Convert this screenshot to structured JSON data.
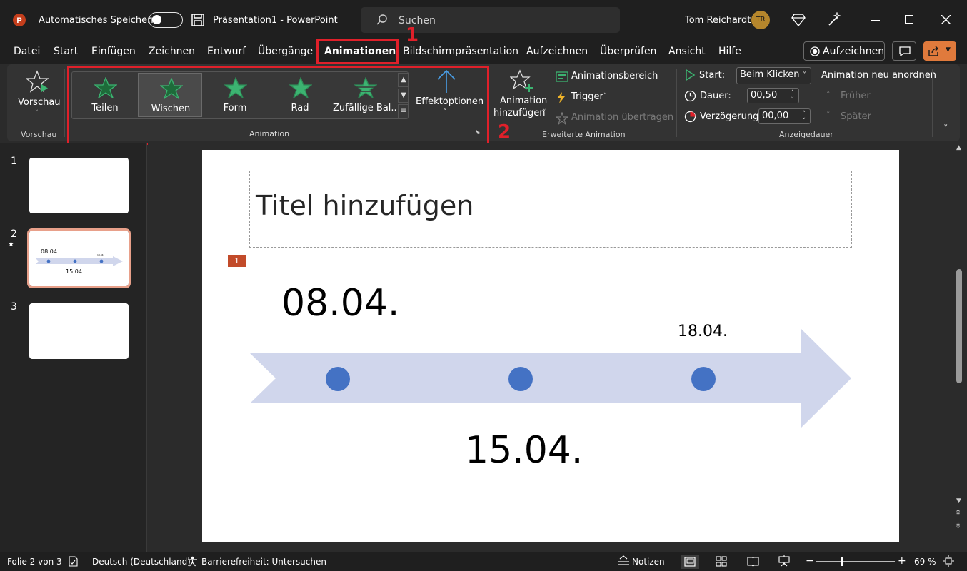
{
  "titlebar": {
    "autosave_label": "Automatisches Speichern",
    "document_title": "Präsentation1  -  PowerPoint",
    "search_placeholder": "Suchen",
    "user_name": "Tom Reichardt",
    "user_initials": "TR"
  },
  "menu": {
    "tabs": [
      "Datei",
      "Start",
      "Einfügen",
      "Zeichnen",
      "Entwurf",
      "Übergänge",
      "Animationen",
      "Bildschirmpräsentation",
      "Aufzeichnen",
      "Überprüfen",
      "Ansicht",
      "Hilfe"
    ],
    "active_tab": "Animationen",
    "record_button": "Aufzeichnen"
  },
  "annotations": {
    "marker_1": "1",
    "marker_2": "2",
    "color": "#e0202a"
  },
  "ribbon": {
    "preview": {
      "label": "Vorschau",
      "group": "Vorschau"
    },
    "animation_group": {
      "label": "Animation",
      "effects": [
        "Teilen",
        "Wischen",
        "Form",
        "Rad",
        "Zufällige Bal..."
      ],
      "selected": "Wischen",
      "effect_options": "Effektoptionen"
    },
    "advanced": {
      "group": "Erweiterte Animation",
      "add_animation_line1": "Animation",
      "add_animation_line2": "hinzufügen",
      "animation_pane": "Animationsbereich",
      "trigger": "Trigger",
      "copy_animation": "Animation übertragen"
    },
    "timing": {
      "group": "Anzeigedauer",
      "start_label": "Start:",
      "start_value": "Beim Klicken",
      "duration_label": "Dauer:",
      "duration_value": "00,50",
      "delay_label": "Verzögerung:",
      "delay_value": "00,00",
      "reorder_title": "Animation neu anordnen",
      "earlier": "Früher",
      "later": "Später"
    },
    "accent_green": "#3cb371"
  },
  "slides_panel": {
    "numbers": [
      "1",
      "2",
      "3"
    ],
    "selected": "2",
    "thumb2_dates": [
      "08.04.",
      "15.04.",
      "18.04."
    ]
  },
  "slide": {
    "title_placeholder": "Titel hinzufügen",
    "animation_tag": "1",
    "date_top_left": "08.04.",
    "date_top_right": "18.04.",
    "date_bottom": "15.04.",
    "arrow_color": "#d0d6ec",
    "dot_color": "#4472c4"
  },
  "statusbar": {
    "slide_info": "Folie 2 von 3",
    "language": "Deutsch (Deutschland)",
    "accessibility": "Barrierefreiheit: Untersuchen",
    "notes": "Notizen",
    "zoom": "69 %"
  }
}
